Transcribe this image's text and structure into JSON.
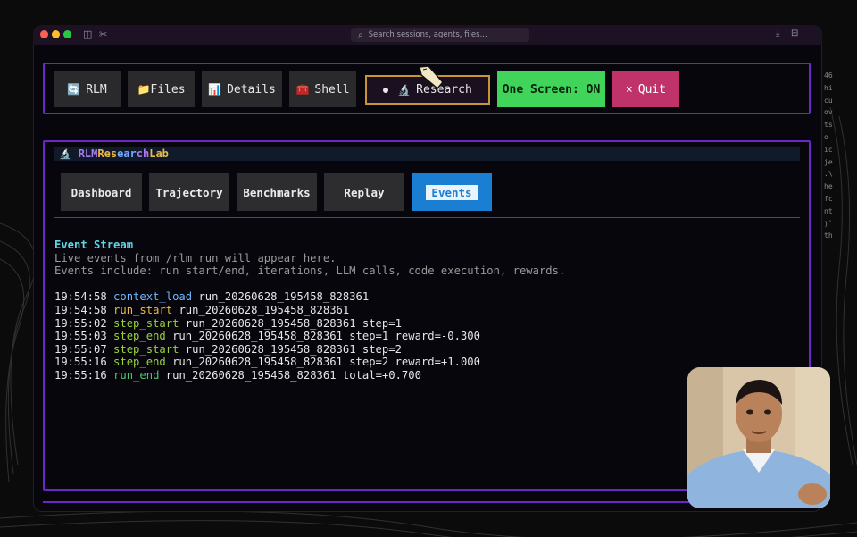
{
  "window": {
    "search_placeholder": "Search sessions, agents, files..."
  },
  "nav": {
    "buttons": [
      {
        "icon": "rlm-logo-icon",
        "label": "RLM"
      },
      {
        "icon": "folder-icon",
        "label": "Files"
      },
      {
        "icon": "bar-chart-icon",
        "label": "Details"
      },
      {
        "icon": "toolbox-icon",
        "label": "Shell"
      },
      {
        "icon": "microscope-icon",
        "label": "Research"
      },
      {
        "label": "One Screen: ON"
      },
      {
        "icon": "close-icon",
        "label": "Quit"
      }
    ]
  },
  "lab": {
    "title_parts": [
      "RLM ",
      "Res",
      "ear",
      "ch ",
      "Lab"
    ],
    "tabs": [
      "Dashboard",
      "Trajectory",
      "Benchmarks",
      "Replay",
      "Events"
    ],
    "active_tab": "Events"
  },
  "stream": {
    "title": "Event Stream",
    "desc1": "Live events from /rlm run will appear here.",
    "desc2": "Events include: run start/end, iterations, LLM calls, code execution, rewards.",
    "events": [
      {
        "time": "19:54:58",
        "type": "context_load",
        "detail": "run_20260628_195458_828361"
      },
      {
        "time": "19:54:58",
        "type": "run_start",
        "detail": "run_20260628_195458_828361"
      },
      {
        "time": "19:55:02",
        "type": "step_start",
        "detail": "run_20260628_195458_828361 step=1"
      },
      {
        "time": "19:55:03",
        "type": "step_end",
        "detail": "run_20260628_195458_828361 step=1 reward=-0.300"
      },
      {
        "time": "19:55:07",
        "type": "step_start",
        "detail": "run_20260628_195458_828361 step=2"
      },
      {
        "time": "19:55:16",
        "type": "step_end",
        "detail": "run_20260628_195458_828361 step=2 reward=+1.000"
      },
      {
        "time": "19:55:16",
        "type": "run_end",
        "detail": "run_20260628_195458_828361 total=+0.700"
      }
    ]
  },
  "gutter_text": "46\nhi\ncu\nov\nts\no\nic\nje\n.\\\nhe\nfc\nnt\n)`\nth"
}
